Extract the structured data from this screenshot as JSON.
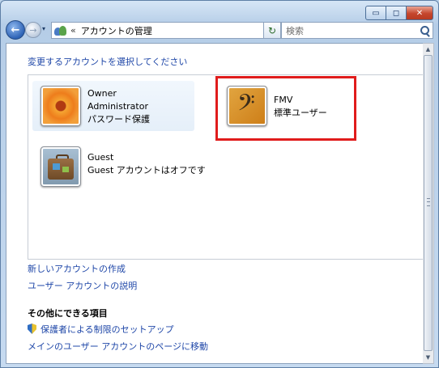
{
  "window": {
    "caption_buttons": {
      "minimize": "▭",
      "maximize": "◻",
      "close": "✕"
    }
  },
  "navbar": {
    "back": "←",
    "forward": "→",
    "address_separator": "«",
    "address_text": "アカウントの管理",
    "dropdown_arrow": "▾",
    "refresh": "↻",
    "search_placeholder": "検索"
  },
  "content": {
    "instruction_link": "変更するアカウントを選択してください",
    "accounts": [
      {
        "name": "Owner",
        "line2": "Administrator",
        "line3": "パスワード保護",
        "picture": "flower-icon"
      },
      {
        "name": "FMV",
        "line2": "標準ユーザー",
        "picture": "music-clef-icon"
      },
      {
        "name": "Guest",
        "line2": "Guest アカウントはオフです",
        "picture": "suitcase-icon"
      }
    ],
    "links": {
      "create_account": "新しいアカウントの作成",
      "about_accounts": "ユーザー アカウントの説明"
    },
    "other_tasks": {
      "heading": "その他にできる項目",
      "parental_controls": "保護者による制限のセットアップ",
      "main_page": "メインのユーザー アカウントのページに移動"
    }
  },
  "colors": {
    "link": "#1f47a8",
    "highlight_border": "#e01c1c",
    "selected_tile": "#e5eff9"
  }
}
